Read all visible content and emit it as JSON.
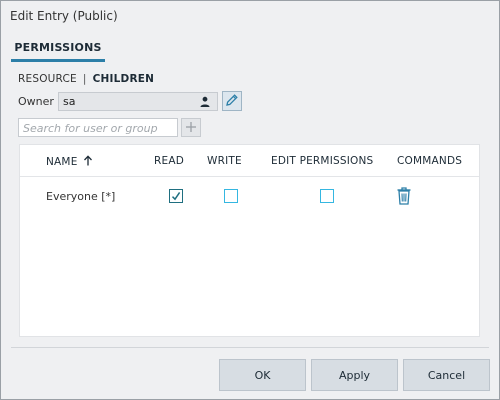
{
  "dialog": {
    "title": "Edit Entry (Public)"
  },
  "tabs": [
    {
      "label": "PERMISSIONS",
      "active": true
    }
  ],
  "scope": {
    "resource_label": "RESOURCE",
    "separator": "|",
    "children_label": "CHILDREN"
  },
  "owner": {
    "label": "Owner",
    "value": "sa",
    "icon": "person-icon",
    "edit_icon": "pencil-icon"
  },
  "search": {
    "placeholder": "Search for user or group",
    "value": "",
    "add_icon": "plus-icon"
  },
  "table": {
    "columns": [
      {
        "key": "name",
        "label": "NAME",
        "sorted": "ascending"
      },
      {
        "key": "read",
        "label": "READ"
      },
      {
        "key": "write",
        "label": "WRITE"
      },
      {
        "key": "edit_permissions",
        "label": "EDIT PERMISSIONS"
      },
      {
        "key": "commands",
        "label": "COMMANDS"
      }
    ],
    "rows": [
      {
        "name": "Everyone [*]",
        "read": true,
        "write": false,
        "edit_permissions": false,
        "command_icon": "trash-icon"
      }
    ]
  },
  "footer": {
    "ok_label": "OK",
    "apply_label": "Apply",
    "cancel_label": "Cancel"
  },
  "colors": {
    "accent": "#2c7fa8",
    "checkbox_border": "#35b7e1",
    "checked": "#1f6f80",
    "background": "#eff0f2"
  }
}
